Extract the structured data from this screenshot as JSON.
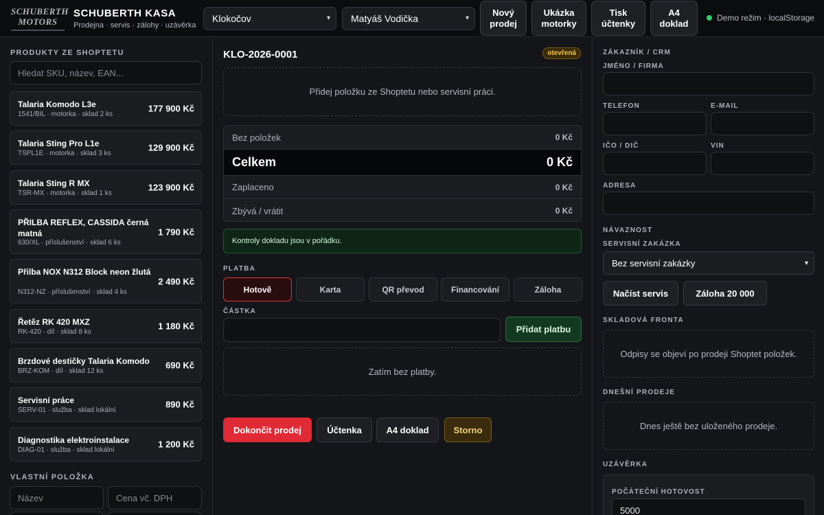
{
  "header": {
    "logo_text": "SCHUBERTH MOTORS",
    "title": "SCHUBERTH KASA",
    "subtitle": "Prodejna · servis · zálohy · uzávěrka",
    "store_select": "Klokočov",
    "seller_select": "Matyáš Vodička",
    "buttons": {
      "new_sale": "Nový prodej",
      "demo_moto": "Ukázka motorky",
      "print_receipt": "Tisk účtenky",
      "a4_doc": "A4 doklad"
    },
    "demo_mode": "Demo režim · localStorage",
    "status_color": "#2fd06a"
  },
  "products": {
    "section_title": "PRODUKTY ZE SHOPTETU",
    "search_placeholder": "Hledat SKU, název, EAN...",
    "items": [
      {
        "name": "Talaria Komodo L3e",
        "meta": "1541/BIL · motorka · sklad 2 ks",
        "price": "177 900 Kč"
      },
      {
        "name": "Talaria Sting Pro L1e",
        "meta": "TSPL1E · motorka · sklad 3 ks",
        "price": "129 900 Kč"
      },
      {
        "name": "Talaria Sting R MX",
        "meta": "TSR-MX · motorka · sklad 1 ks",
        "price": "123 900 Kč"
      },
      {
        "name": "PŘILBA REFLEX, CASSIDA černá matná",
        "meta": "630/XL · příslušenství · sklad 6 ks",
        "price": "1 790 Kč"
      },
      {
        "name": "Přilba NOX N312 Block neon žlutá",
        "meta": "N312-NZ · příslušenství · sklad 4 ks",
        "price": "2 490 Kč"
      },
      {
        "name": "Řetěz RK 420 MXZ",
        "meta": "RK-420 · díl · sklad 8 ks",
        "price": "1 180 Kč"
      },
      {
        "name": "Brzdové destičky Talaria Komodo",
        "meta": "BRZ-KOM · díl · sklad 12 ks",
        "price": "690 Kč"
      },
      {
        "name": "Servisní práce",
        "meta": "SERV-01 · služba · sklad lokální",
        "price": "890 Kč"
      },
      {
        "name": "Diagnostika elektroinstalace",
        "meta": "DIAG-01 · služba · sklad lokální",
        "price": "1 200 Kč"
      }
    ],
    "custom_title": "VLASTNÍ POLOŽKA",
    "custom_name_placeholder": "Název",
    "custom_price_placeholder": "Cena vč. DPH"
  },
  "receipt": {
    "number": "KLO-2026-0001",
    "status": "otevřená",
    "empty_text": "Přidej položku ze Shoptetu nebo servisní práci.",
    "rows": {
      "items_label": "Bez položek",
      "items_value": "0 Kč",
      "total_label": "Celkem",
      "total_value": "0 Kč",
      "paid_label": "Zaplaceno",
      "paid_value": "0 Kč",
      "remaining_label": "Zbývá / vrátit",
      "remaining_value": "0 Kč"
    },
    "check_ok": "Kontroly dokladu jsou v pořádku."
  },
  "payment": {
    "title": "PLATBA",
    "methods": [
      "Hotově",
      "Karta",
      "QR převod",
      "Financování",
      "Záloha"
    ],
    "amount_label": "ČÁSTKA",
    "add_button": "Přidat platbu",
    "empty_text": "Zatím bez platby."
  },
  "actions": {
    "finish": "Dokončit prodej",
    "receipt": "Účtenka",
    "a4": "A4 doklad",
    "cancel": "Storno"
  },
  "customer": {
    "title": "ZÁKAZNÍK / CRM",
    "name_label": "JMÉNO / FIRMA",
    "phone_label": "TELEFON",
    "email_label": "E-MAIL",
    "ico_label": "IČO / DIČ",
    "vin_label": "VIN",
    "address_label": "ADRESA"
  },
  "linking": {
    "title": "NÁVAZNOST",
    "service_label": "SERVISNÍ ZAKÁZKA",
    "service_value": "Bez servisní zakázky",
    "load_service": "Načíst servis",
    "deposit": "Záloha 20 000"
  },
  "stock": {
    "title": "SKLADOVÁ FRONTA",
    "empty": "Odpisy se objeví po prodeji Shoptet položek."
  },
  "today": {
    "title": "DNEŠNÍ PRODEJE",
    "empty": "Dnes ještě bez uloženého prodeje."
  },
  "closing": {
    "title": "UZÁVĚRKA",
    "cash_label": "POČÁTEČNÍ HOTOVOST",
    "cash_value": "5000"
  }
}
